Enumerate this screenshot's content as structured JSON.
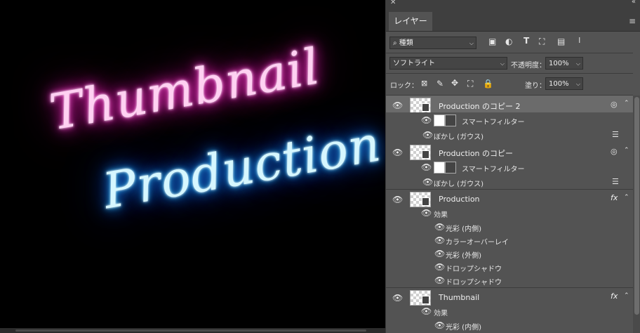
{
  "canvas": {
    "line1": "Thumbnail",
    "line2": "Production",
    "colors": {
      "pink_glow": "#ff2ccf",
      "blue_glow": "#1a8cff",
      "background": "#000000"
    }
  },
  "panel": {
    "tab_label": "レイヤー",
    "filter": {
      "value": "種類"
    },
    "blend_mode": "ソフトライト",
    "opacity_label": "不透明度：",
    "opacity_value": "100%",
    "lock_label": "ロック：",
    "fill_label": "塗り：",
    "fill_value": "100%"
  },
  "layers": [
    {
      "name": "Production のコピー 2",
      "selected": true,
      "smart_filter": "スマートフィルター",
      "filter_item": "ぼかし (ガウス)"
    },
    {
      "name": "Production のコピー",
      "selected": false,
      "smart_filter": "スマートフィルター",
      "filter_item": "ぼかし (ガウス)"
    },
    {
      "name": "Production",
      "effects_label": "効果",
      "effects": [
        "光彩 (内側)",
        "カラーオーバーレイ",
        "光彩 (外側)",
        "ドロップシャドウ",
        "ドロップシャドウ"
      ]
    },
    {
      "name": "Thumbnail",
      "effects_label": "効果",
      "effects": [
        "光彩 (内側)"
      ]
    }
  ],
  "fx_label": "fx"
}
